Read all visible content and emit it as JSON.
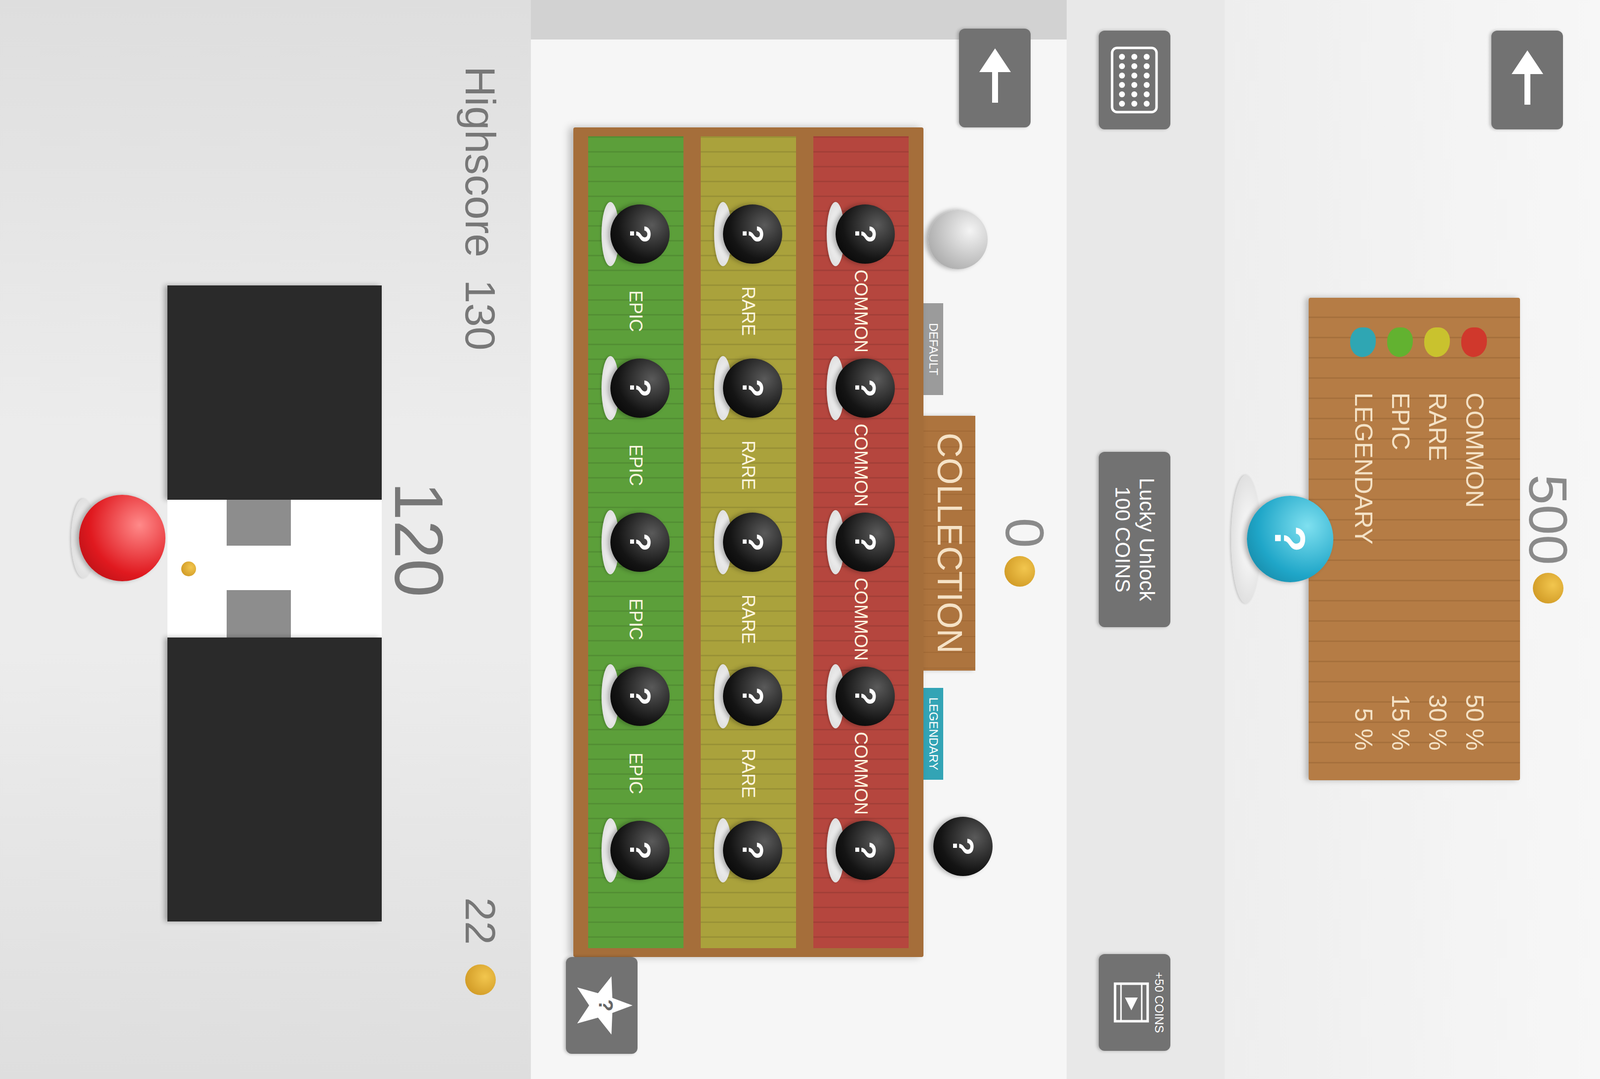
{
  "shop": {
    "coins": "500",
    "ball_mark": "?",
    "odds": [
      {
        "rarity": "COMMON",
        "chance": "50 %",
        "color": "#d0382c"
      },
      {
        "rarity": "RARE",
        "chance": "30 %",
        "color": "#c9c22e"
      },
      {
        "rarity": "EPIC",
        "chance": "15 %",
        "color": "#62b230"
      },
      {
        "rarity": "LEGENDARY",
        "chance": "5 %",
        "color": "#2fa6b3"
      }
    ]
  },
  "buttons": {
    "lucky_unlock": {
      "label": "Lucky Unlock",
      "price": "100 COINS"
    },
    "video_reward": "+50 COINS",
    "star_mark": "?"
  },
  "collection": {
    "coins": "0",
    "title": "COLLECTION",
    "tags": [
      {
        "label": "DEFAULT",
        "color": "#9b9b9b"
      },
      {
        "label": "LEGENDARY",
        "color": "#33a4b5"
      }
    ],
    "loose_ball": {
      "mark": "?",
      "unlocked": false
    },
    "shelves": [
      {
        "color": "#b5463e",
        "labels": [
          "COMMON",
          "COMMON",
          "COMMON",
          "COMMON"
        ],
        "balls": [
          {
            "mark": "?",
            "unlocked": false
          },
          {
            "mark": "?",
            "unlocked": false
          },
          {
            "mark": "?",
            "unlocked": false
          },
          {
            "mark": "?",
            "unlocked": false
          },
          {
            "mark": "?",
            "unlocked": false
          }
        ]
      },
      {
        "color": "#aaa23c",
        "labels": [
          "RARE",
          "RARE",
          "RARE",
          "RARE"
        ],
        "balls": [
          {
            "mark": "?",
            "unlocked": false
          },
          {
            "mark": "?",
            "unlocked": false
          },
          {
            "mark": "?",
            "unlocked": false
          },
          {
            "mark": "?",
            "unlocked": false
          },
          {
            "mark": "?",
            "unlocked": false
          }
        ]
      },
      {
        "color": "#5c9f3a",
        "labels": [
          "EPIC",
          "EPIC",
          "EPIC",
          "EPIC"
        ],
        "balls": [
          {
            "mark": "?",
            "unlocked": false
          },
          {
            "mark": "?",
            "unlocked": false
          },
          {
            "mark": "?",
            "unlocked": false
          },
          {
            "mark": "?",
            "unlocked": false
          },
          {
            "mark": "?",
            "unlocked": false
          }
        ]
      }
    ]
  },
  "game": {
    "highscore_label": "Highscore",
    "highscore": "130",
    "score": "120",
    "coins": "22"
  }
}
